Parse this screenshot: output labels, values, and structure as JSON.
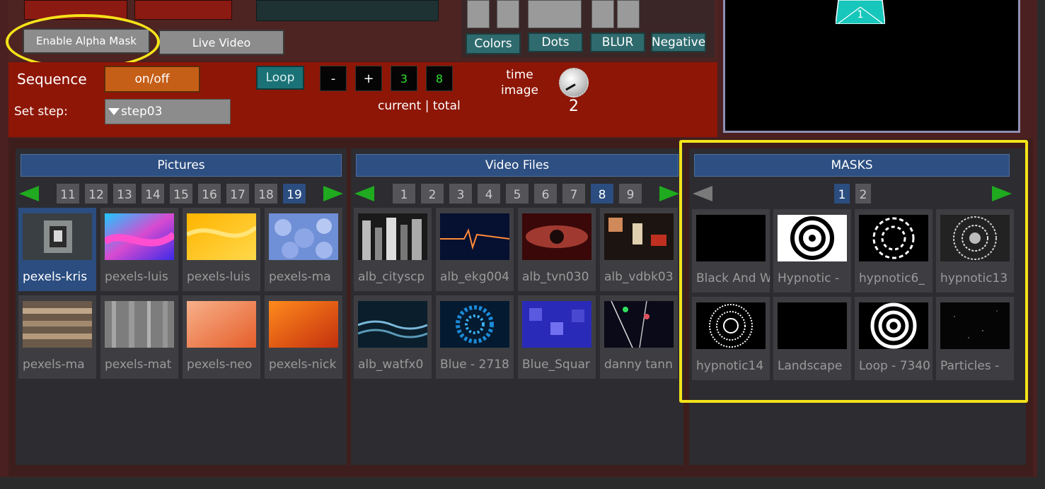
{
  "colors": {
    "accent_blue": "#2d4f82",
    "sequence_band": "#8e1606",
    "highlight": "#f5e31a",
    "green_arrow": "#1faa1f",
    "counter_text": "#33e033"
  },
  "top": {
    "alpha_mask_label": "Enable Alpha Mask",
    "live_video_label": "Live Video",
    "effects": [
      "Colors",
      "Dots",
      "BLUR",
      "Negative"
    ]
  },
  "sequence": {
    "label": "Sequence",
    "onoff_label": "on/off",
    "set_step_label": "Set step:",
    "step_value": "step03",
    "loop_label": "Loop",
    "minus_label": "-",
    "plus_label": "+",
    "current": "3",
    "total": "8",
    "current_total_label": "current | total",
    "time_label": "time",
    "image_label": "image",
    "knob_value": "2"
  },
  "preview": {
    "shape_label": "1"
  },
  "pictures": {
    "title": "Pictures",
    "pages": [
      "11",
      "12",
      "13",
      "14",
      "15",
      "16",
      "17",
      "18",
      "19"
    ],
    "active_page": "19",
    "items": [
      {
        "label": "pexels-kris",
        "thumb": "stairwell-photo",
        "selected": true
      },
      {
        "label": "pexels-luis",
        "thumb": "fluid-pink-blue"
      },
      {
        "label": "pexels-luis",
        "thumb": "fluid-yellow"
      },
      {
        "label": "pexels-ma",
        "thumb": "blue-flowers"
      },
      {
        "label": "pexels-ma",
        "thumb": "wood-planks"
      },
      {
        "label": "pexels-mat",
        "thumb": "gray-wood"
      },
      {
        "label": "pexels-neo",
        "thumb": "orange-texture"
      },
      {
        "label": "pexels-nick",
        "thumb": "orange-fur"
      }
    ]
  },
  "videos": {
    "title": "Video Files",
    "pages": [
      "1",
      "2",
      "3",
      "4",
      "5",
      "6",
      "7",
      "8",
      "9"
    ],
    "active_page": "8",
    "items": [
      {
        "label": "alb_cityscp",
        "thumb": "cityscape"
      },
      {
        "label": "alb_ekg004",
        "thumb": "ekg"
      },
      {
        "label": "alb_tvn030",
        "thumb": "eye"
      },
      {
        "label": "alb_vdbk03",
        "thumb": "glitch"
      },
      {
        "label": "alb_watfx0",
        "thumb": "water"
      },
      {
        "label": "Blue - 2718",
        "thumb": "blue-swirl"
      },
      {
        "label": "Blue_Squar",
        "thumb": "blue-squares"
      },
      {
        "label": "danny tann",
        "thumb": "lines"
      }
    ]
  },
  "masks": {
    "title": "MASKS",
    "pages": [
      "1",
      "2"
    ],
    "active_page": "1",
    "items": [
      {
        "label": "Black And W",
        "thumb": "black"
      },
      {
        "label": "Hypnotic -",
        "thumb": "spiral"
      },
      {
        "label": "hypnotic6_",
        "thumb": "spiral-rays"
      },
      {
        "label": "hypnotic13",
        "thumb": "spiral-tunnel"
      },
      {
        "label": "hypnotic14",
        "thumb": "radial-circles"
      },
      {
        "label": "Landscape",
        "thumb": "black"
      },
      {
        "label": "Loop - 7340",
        "thumb": "concentric"
      },
      {
        "label": "Particles -",
        "thumb": "particles"
      }
    ]
  }
}
